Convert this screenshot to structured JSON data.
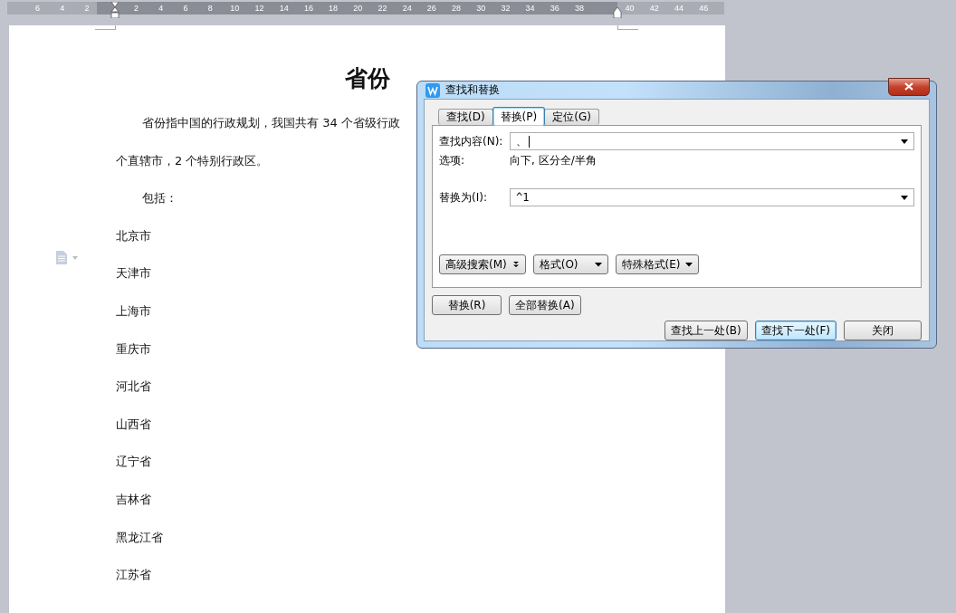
{
  "ruler": {
    "labels": [
      "6",
      "4",
      "2",
      "2",
      "4",
      "6",
      "8",
      "10",
      "12",
      "14",
      "16",
      "18",
      "20",
      "22",
      "24",
      "26",
      "28",
      "30",
      "32",
      "34",
      "36",
      "38",
      "40",
      "42",
      "44",
      "46"
    ]
  },
  "document": {
    "title": "省份",
    "paragraphs": [
      {
        "kind": "indent",
        "text": "省份指中国的行政规划，我国共有 34 个省级行政"
      },
      {
        "kind": "plain",
        "text": "个直辖市，2 个特别行政区。"
      },
      {
        "kind": "indent",
        "text": "包括："
      }
    ],
    "list_items": [
      "北京市",
      "天津市",
      "上海市",
      "重庆市",
      "河北省",
      "山西省",
      "辽宁省",
      "吉林省",
      "黑龙江省",
      "江苏省"
    ]
  },
  "dialog": {
    "title": "查找和替换",
    "tabs": [
      {
        "label": "查找(D)",
        "selected": false
      },
      {
        "label": "替换(P)",
        "selected": true
      },
      {
        "label": "定位(G)",
        "selected": false
      }
    ],
    "find_label": "查找内容(N):",
    "find_value": "、",
    "options_label": "选项:",
    "options_value": "向下, 区分全/半角",
    "replace_label": "替换为(I):",
    "replace_value": "^1",
    "option_buttons": [
      {
        "label": "高级搜索(M)",
        "kind": "expand"
      },
      {
        "label": "格式(O)",
        "kind": "menu"
      },
      {
        "label": "特殊格式(E)",
        "kind": "menu"
      }
    ],
    "replace_buttons": [
      "替换(R)",
      "全部替换(A)"
    ],
    "nav_buttons": [
      {
        "label": "查找上一处(B)",
        "selected": false
      },
      {
        "label": "查找下一处(F)",
        "selected": true
      },
      {
        "label": "关闭",
        "selected": false
      }
    ]
  }
}
